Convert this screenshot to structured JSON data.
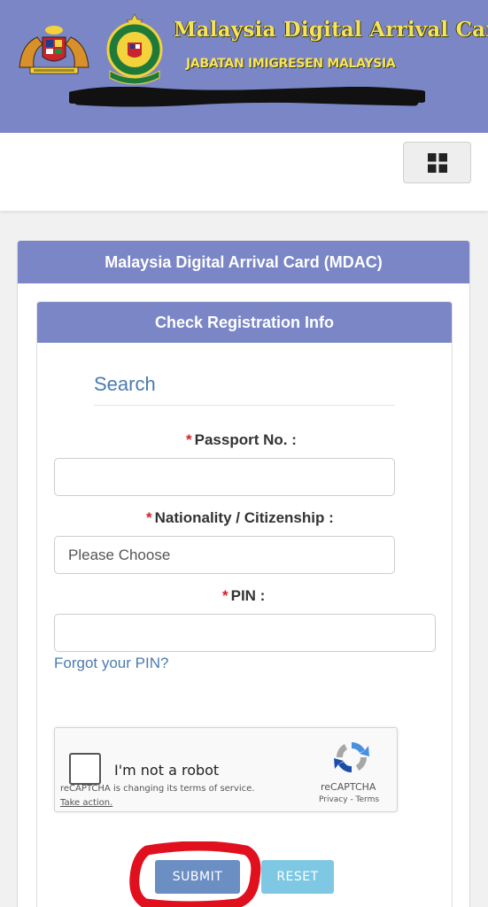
{
  "colors": {
    "banner": "#7a86c6",
    "panel_heading": "#7a86c6",
    "banner_text": "#f7e35a",
    "link": "#4b7bb0",
    "required": "#d0232b",
    "submit": "#6b8ec3",
    "reset": "#7ec8e3",
    "annotation": "#e0101e"
  },
  "header": {
    "title": "Malaysia Digital Arrival Card",
    "subtitle": "JABATAN IMIGRESEN MALAYSIA",
    "crest_icon": "coat-of-arms-icon",
    "emblem_icon": "imigresen-emblem-icon",
    "emblem_text": "IMIGRESEN MALAYSIA"
  },
  "nav": {
    "menu_icon": "grid-icon"
  },
  "panel": {
    "title": "Malaysia Digital Arrival Card (MDAC)"
  },
  "form": {
    "title": "Check Registration Info",
    "section_title": "Search",
    "required_mark": "*",
    "passport": {
      "label": "Passport No. :",
      "value": "",
      "placeholder": ""
    },
    "nationality": {
      "label": "Nationality / Citizenship :",
      "selected": "Please Choose"
    },
    "pin": {
      "label": "PIN :",
      "value": "",
      "placeholder": ""
    },
    "forgot_pin": "Forgot your PIN?"
  },
  "recaptcha": {
    "label": "I'm not a robot",
    "notice": "reCAPTCHA is changing its terms of service.",
    "take_action": "Take action.",
    "brand": "reCAPTCHA",
    "links": "Privacy - Terms",
    "checked": false
  },
  "buttons": {
    "submit": "SUBMIT",
    "reset": "RESET"
  }
}
